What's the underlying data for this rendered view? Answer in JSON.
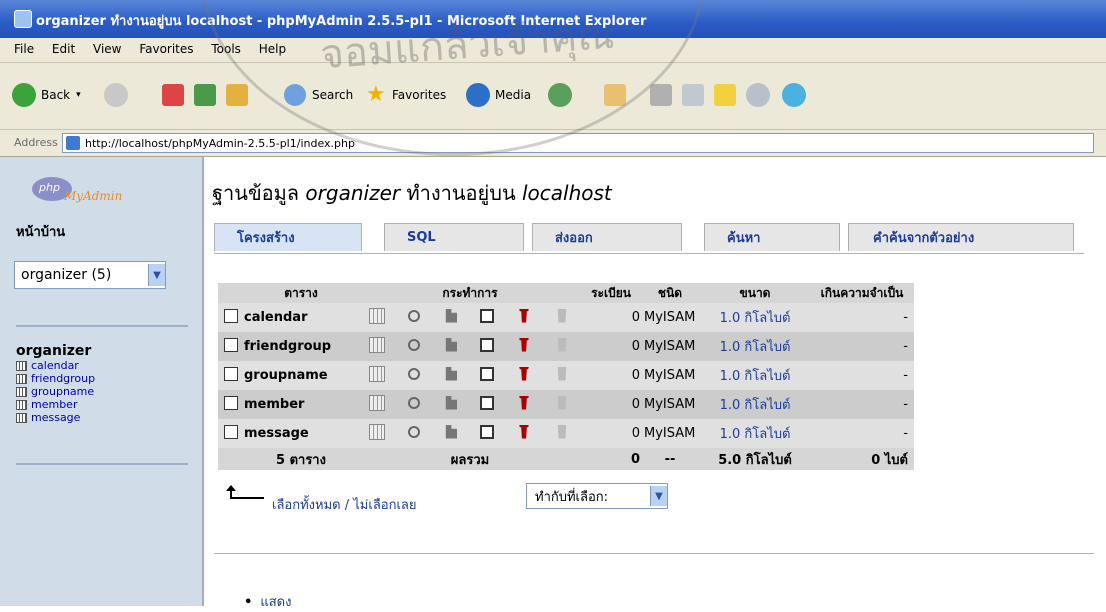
{
  "window": {
    "title": "organizer ทำงานอยู่บน localhost - phpMyAdmin 2.5.5-pl1 - Microsoft Internet Explorer"
  },
  "menu": [
    "File",
    "Edit",
    "View",
    "Favorites",
    "Tools",
    "Help"
  ],
  "toolbar": {
    "back_label": "Back",
    "search_label": "Search",
    "favorites_label": "Favorites",
    "media_label": "Media"
  },
  "address": {
    "label": "Address",
    "url": "http://localhost/phpMyAdmin-2.5.5-pl1/index.php"
  },
  "left": {
    "logo_php": "php",
    "logo_my": "MyAdmin",
    "home": "หน้าบ้าน",
    "db_select": "organizer (5)",
    "db_name": "organizer",
    "tables": [
      "calendar",
      "friendgroup",
      "groupname",
      "member",
      "message"
    ]
  },
  "main": {
    "heading_prefix": "ฐานข้อมูล",
    "heading_db": "organizer",
    "heading_mid": "ทำงานอยู่บน",
    "heading_host": "localhost",
    "tabs": [
      "โครงสร้าง",
      "SQL",
      "ส่งออก",
      "ค้นหา",
      "คำค้นจากตัวอย่าง"
    ],
    "headers": {
      "table": "ตาราง",
      "action": "กระทำการ",
      "records": "ระเบียน",
      "type": "ชนิด",
      "size": "ขนาด",
      "overhead": "เกินความจำเป็น"
    },
    "rows": [
      {
        "name": "calendar",
        "records": "0",
        "type": "MyISAM",
        "size": "1.0 กิโลไบต์",
        "overhead": "-"
      },
      {
        "name": "friendgroup",
        "records": "0",
        "type": "MyISAM",
        "size": "1.0 กิโลไบต์",
        "overhead": "-"
      },
      {
        "name": "groupname",
        "records": "0",
        "type": "MyISAM",
        "size": "1.0 กิโลไบต์",
        "overhead": "-"
      },
      {
        "name": "member",
        "records": "0",
        "type": "MyISAM",
        "size": "1.0 กิโลไบต์",
        "overhead": "-"
      },
      {
        "name": "message",
        "records": "0",
        "type": "MyISAM",
        "size": "1.0 กิโลไบต์",
        "overhead": "-"
      }
    ],
    "footer": {
      "count": "5 ตาราง",
      "sum": "ผลรวม",
      "records": "0",
      "type": "--",
      "size": "5.0 กิโลไบต์",
      "overhead": "0 ไบต์"
    },
    "check_all": "เลือกทั้งหมด",
    "separator": "/",
    "uncheck_all": "ไม่เลือกเลย",
    "with_selected": "ทำกับที่เลือก:",
    "bullet_link": "แสดง"
  },
  "watermark": {
    "text": "จอมแกล้วเจ้าคุณ"
  },
  "colors": {
    "titlebar": "#2a5bc6",
    "left_frame": "#d0dce8",
    "tab_text": "#1a3c9a",
    "row_bg": "#e0e0e0"
  }
}
